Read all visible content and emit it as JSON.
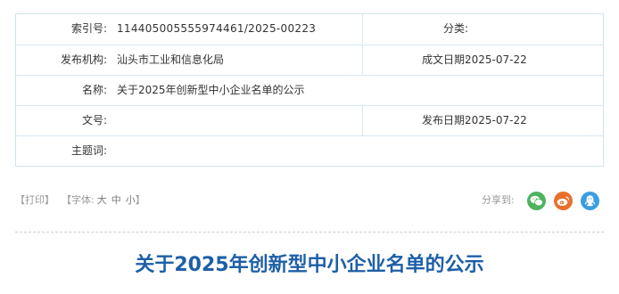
{
  "meta": {
    "index_label": "索引号:",
    "index_value": "114405005555974461/2025-00223",
    "category_label": "分类:",
    "category_value": "",
    "issuer_label": "发布机构:",
    "issuer_value": "汕头市工业和信息化局",
    "created_label": "成文日期:",
    "created_value": "2025-07-22",
    "name_label": "名称:",
    "name_value": "关于2025年创新型中小企业名单的公示",
    "docno_label": "文号:",
    "docno_value": "",
    "published_label": "发布日期:",
    "published_value": "2025-07-22",
    "subject_label": "主题词:",
    "subject_value": ""
  },
  "tools": {
    "print": "【打印】",
    "font_prefix": "【字体:",
    "font_large": "大",
    "font_medium": "中",
    "font_small": "小",
    "font_suffix": "】"
  },
  "share": {
    "label": "分享到:",
    "buttons": [
      {
        "icon": "wechat-icon",
        "color": "#4db35e"
      },
      {
        "icon": "weibo-icon",
        "color": "#e8702a"
      },
      {
        "icon": "qq-icon",
        "color": "#3a9ee0"
      }
    ]
  },
  "article": {
    "title": "关于2025年创新型中小企业名单的公示"
  }
}
